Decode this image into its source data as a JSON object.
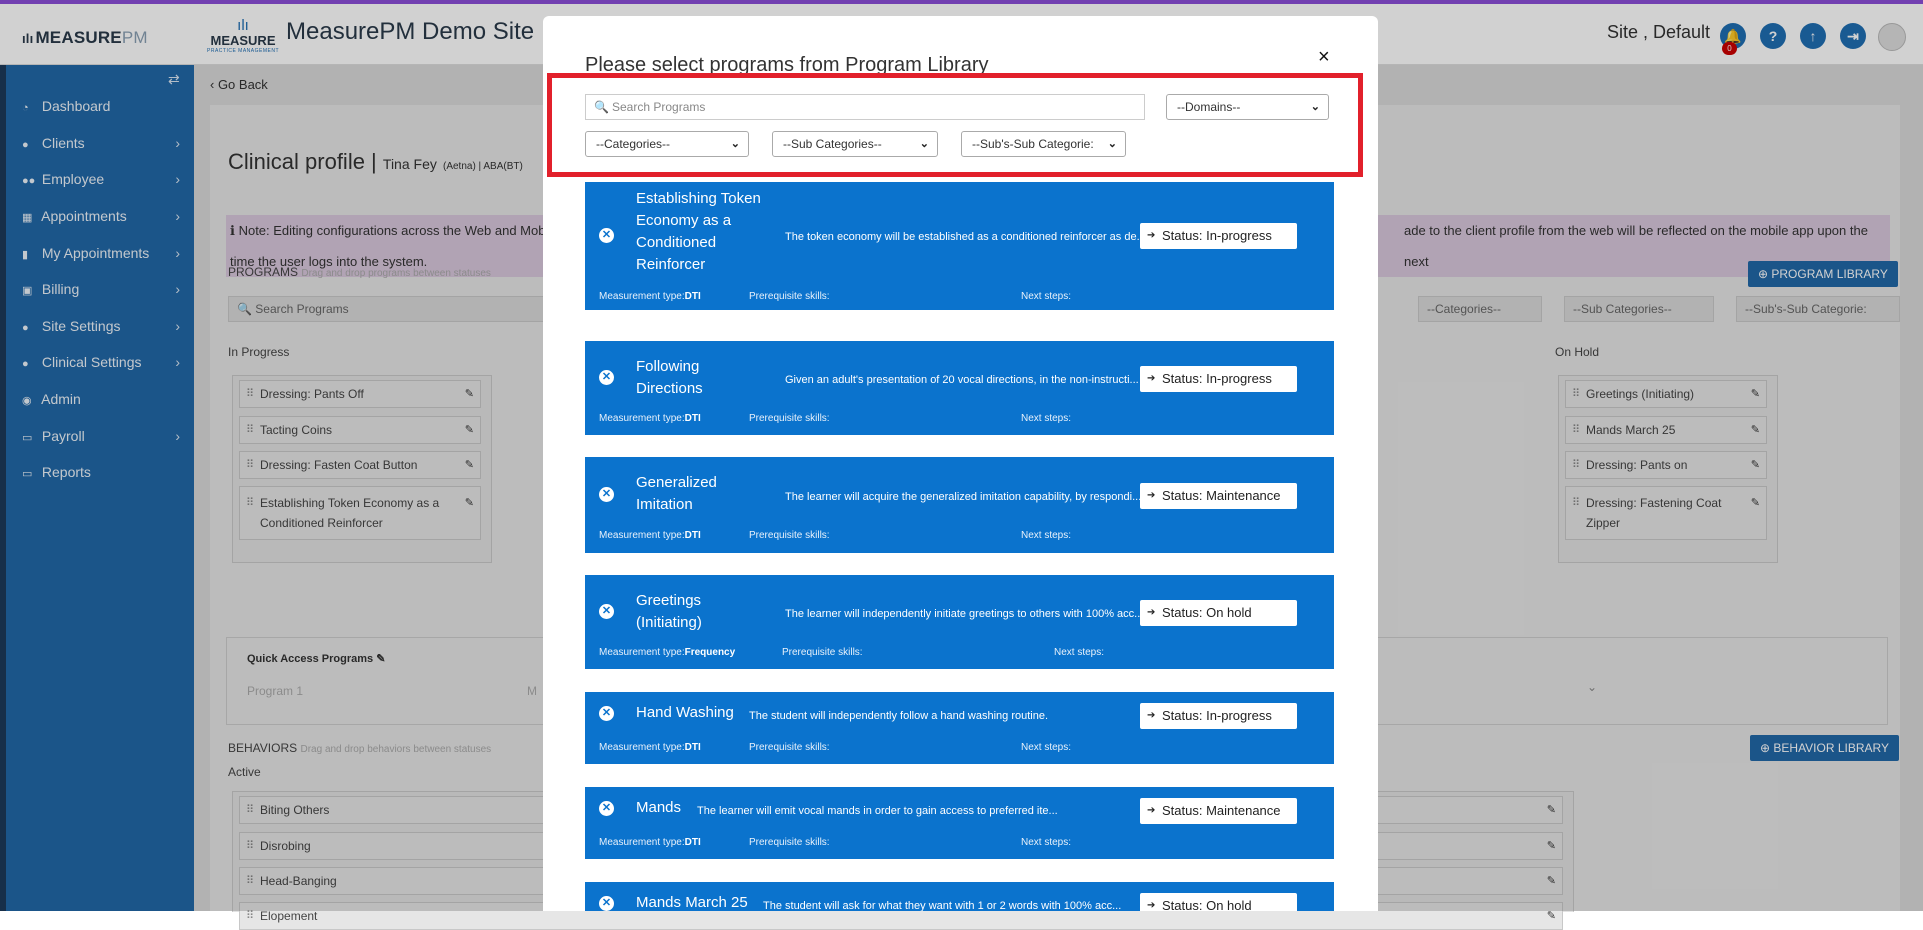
{
  "app": {
    "brand": "MEASURE",
    "brand_pm": "PM",
    "logo_l1": "ılı",
    "logo_l2": "MEASURE",
    "logo_l3": "PRACTICE MANAGEMENT",
    "site_title": "MeasurePM Demo Site",
    "site_label": "Site , Default",
    "notification_count": "0"
  },
  "sidebar": {
    "items": [
      {
        "label": "Dashboard",
        "icon": "dashboard-icon",
        "has_submenu": false
      },
      {
        "label": "Clients",
        "icon": "user-icon",
        "has_submenu": true
      },
      {
        "label": "Employee",
        "icon": "users-icon",
        "has_submenu": true
      },
      {
        "label": "Appointments",
        "icon": "calendar-icon",
        "has_submenu": true
      },
      {
        "label": "My Appointments",
        "icon": "book-icon",
        "has_submenu": true
      },
      {
        "label": "Billing",
        "icon": "money-icon",
        "has_submenu": true
      },
      {
        "label": "Site Settings",
        "icon": "user-icon",
        "has_submenu": true
      },
      {
        "label": "Clinical Settings",
        "icon": "user-icon",
        "has_submenu": true
      },
      {
        "label": "Admin",
        "icon": "user-circle-icon",
        "has_submenu": false
      },
      {
        "label": "Payroll",
        "icon": "card-icon",
        "has_submenu": true
      },
      {
        "label": "Reports",
        "icon": "card-icon",
        "has_submenu": false
      }
    ]
  },
  "page": {
    "go_back": "‹ Go Back",
    "title": "Clinical profile |",
    "client_name": "Tina Fey",
    "client_meta": "(Aetna) | ABA(BT)",
    "note_line1": "Note: Editing configurations across the Web and Mobi",
    "note_line1_right": "ade to the client profile from the web will be reflected on the mobile app upon the next",
    "note_line2": "time the user logs into the system.",
    "programs_label": "PROGRAMS",
    "programs_hint": "Drag and drop programs between statuses",
    "search_placeholder": "Search Programs",
    "program_library_btn": "PROGRAM LIBRARY",
    "filters": {
      "categories": "--Categories--",
      "sub_categories": "--Sub Categories--",
      "subsub_categories": "--Sub's-Sub Categorie:"
    },
    "in_progress_label": "In Progress",
    "on_hold_label": "On Hold",
    "in_progress_items": [
      "Dressing: Pants Off",
      "Tacting Coins",
      "Dressing: Fasten Coat Button",
      "Establishing Token Economy as a Conditioned Reinforcer"
    ],
    "on_hold_items": [
      "Greetings (Initiating)",
      "Mands March 25",
      "Dressing: Pants on",
      "Dressing: Fastening Coat Zipper"
    ],
    "quick_access_label": "Quick Access Programs",
    "quick_access_placeholder": "Program 1",
    "quick_access_m": "M",
    "behaviors_label": "BEHAVIORS",
    "behaviors_hint": "Drag and drop behaviors between statuses",
    "behavior_library_btn": "BEHAVIOR LIBRARY",
    "active_label": "Active",
    "behavior_items": [
      "Biting Others",
      "Disrobing",
      "Head-Banging",
      "Elopement"
    ]
  },
  "modal": {
    "title": "Please select programs from Program Library",
    "close": "×",
    "search_placeholder": "Search Programs",
    "domains": "--Domains--",
    "categories": "--Categories--",
    "sub_categories": "--Sub Categories--",
    "subsub_categories": "--Sub's-Sub Categorie:",
    "programs": [
      {
        "name": "Establishing Token Economy as a Conditioned Reinforcer",
        "desc": "The token economy will be established as a conditioned reinforcer as de...",
        "status": "Status: In-progress",
        "measurement_label": "Measurement type:",
        "measurement": "DTI",
        "prereq": "Prerequisite skills:",
        "next": "Next steps:"
      },
      {
        "name": "Following Directions",
        "desc": "Given an adult's presentation of 20 vocal directions, in the non-instructi...",
        "status": "Status: In-progress",
        "measurement_label": "Measurement type:",
        "measurement": "DTI",
        "prereq": "Prerequisite skills:",
        "next": "Next steps:"
      },
      {
        "name": "Generalized Imitation",
        "desc": "The learner will acquire the generalized imitation capability, by respondi...",
        "status": "Status: Maintenance",
        "measurement_label": "Measurement type:",
        "measurement": "DTI",
        "prereq": "Prerequisite skills:",
        "next": "Next steps:"
      },
      {
        "name": "Greetings (Initiating)",
        "desc": "The learner will independently initiate greetings to others with 100% acc...",
        "status": "Status: On hold",
        "measurement_label": "Measurement type:",
        "measurement": "Frequency",
        "prereq": "Prerequisite skills:",
        "next": "Next steps:"
      },
      {
        "name": "Hand Washing",
        "desc": "The student will independently follow a hand washing routine.",
        "status": "Status: In-progress",
        "measurement_label": "Measurement type:",
        "measurement": "DTI",
        "prereq": "Prerequisite skills:",
        "next": "Next steps:"
      },
      {
        "name": "Mands",
        "desc": "The learner will emit vocal mands in order to gain access to preferred ite...",
        "status": "Status: Maintenance",
        "measurement_label": "Measurement type:",
        "measurement": "DTI",
        "prereq": "Prerequisite skills:",
        "next": "Next steps:"
      },
      {
        "name": "Mands March 25",
        "desc": "The student will ask for what they want with 1 or 2 words with 100% acc...",
        "status": "Status: On hold",
        "measurement_label": "",
        "measurement": "",
        "prereq": "",
        "next": ""
      }
    ]
  },
  "colors": {
    "sidebar": "#2268a8",
    "card": "#0b73cd",
    "highlight": "#e2202b",
    "accent": "#8b4fd8"
  }
}
